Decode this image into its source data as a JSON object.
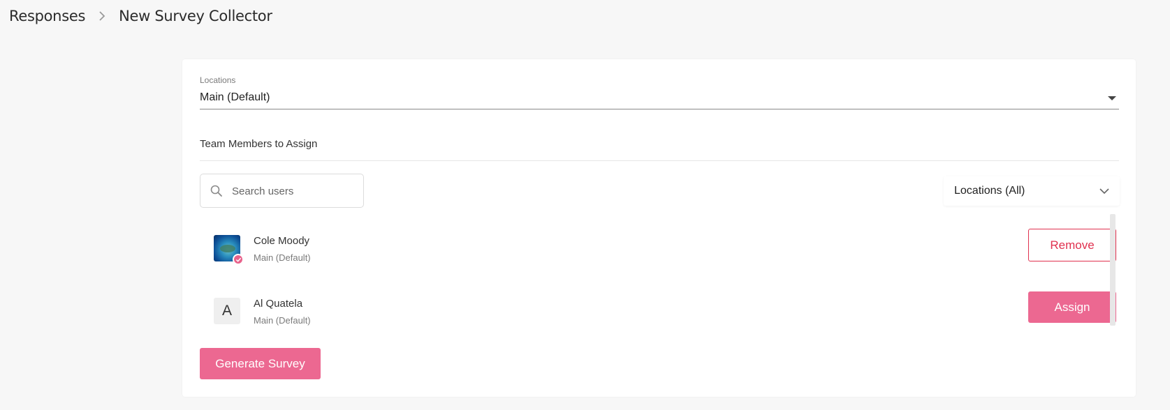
{
  "breadcrumb": {
    "parent": "Responses",
    "current": "New Survey Collector"
  },
  "locations_select": {
    "label": "Locations",
    "value": "Main (Default)"
  },
  "team": {
    "heading": "Team Members to Assign"
  },
  "search": {
    "placeholder": "Search users",
    "value": ""
  },
  "location_filter": {
    "value": "Locations (All)"
  },
  "users": [
    {
      "name": "Cole Moody",
      "location": "Main (Default)",
      "avatar": "photo",
      "assigned": true,
      "action_label": "Remove"
    },
    {
      "name": "Al Quatela",
      "location": "Main (Default)",
      "avatar_letter": "A",
      "assigned": false,
      "action_label": "Assign"
    }
  ],
  "actions": {
    "generate_label": "Generate Survey"
  },
  "colors": {
    "accent": "#ec6891",
    "danger": "#e0314f",
    "background": "#f7f7f7",
    "card": "#ffffff"
  }
}
